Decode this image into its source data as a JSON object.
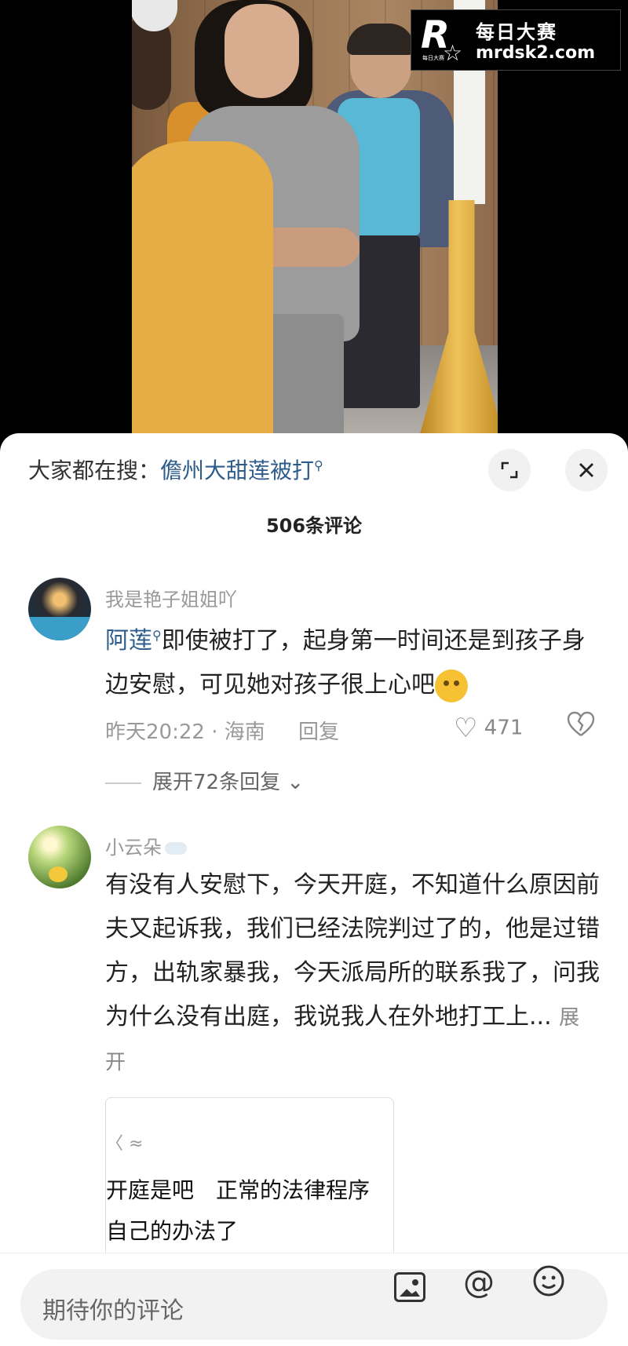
{
  "watermark": {
    "logo_letter": "R",
    "logo_small": "每日大赛",
    "brand_cn": "每日大赛",
    "url": "mrdsk2.com"
  },
  "search": {
    "label": "大家都在搜：",
    "keyword": "儋州大甜莲被打"
  },
  "comment_count": "506条评论",
  "comments": [
    {
      "user": "我是艳子姐姐吖",
      "mention": "阿莲",
      "text": "即使被打了，起身第一时间还是到孩子身边安慰，可见她对孩子很上心吧",
      "time_location": "昨天20:22 · 海南",
      "reply_label": "回复",
      "likes": "471",
      "expand_label": "展开72条回复"
    },
    {
      "user": "小云朵",
      "text": "有没有人安慰下，今天开庭，不知道什么原因前夫又起诉我，我们已经法院判过了的，他是过错方，出轨家暴我，今天派局所的联系我了，问我为什么没有出庭，我说我人在外地打工上...",
      "more_label": "展开",
      "attachment": {
        "line1": "开庭是吧　正常的法律程序",
        "line2": "自己的办法了"
      }
    }
  ],
  "input": {
    "placeholder": "期待你的评论"
  },
  "icons": {
    "expand": "expand-icon",
    "close": "close-icon",
    "like": "heart-icon",
    "dislike": "broken-heart-icon",
    "image": "image-icon",
    "at": "at-icon",
    "emoji": "smile-icon"
  },
  "colors": {
    "link": "#2e5d8c",
    "muted": "#999999"
  }
}
